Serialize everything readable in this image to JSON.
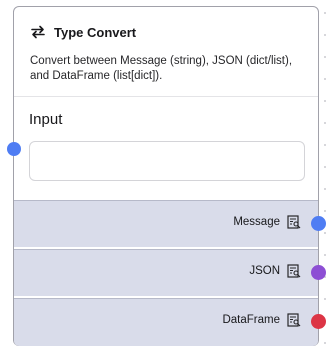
{
  "node": {
    "title": "Type Convert",
    "description": "Convert between Message (string), JSON (dict/list), and DataFrame (list[dict]).",
    "icon": "arrows-swap-icon"
  },
  "input": {
    "label": "Input",
    "value": "",
    "placeholder": "",
    "handle_color": "#4f7df3"
  },
  "outputs": [
    {
      "label": "Message",
      "icon": "inspect-icon",
      "handle_color": "#4f7df3"
    },
    {
      "label": "JSON",
      "icon": "inspect-icon",
      "handle_color": "#8d4fd4"
    },
    {
      "label": "DataFrame",
      "icon": "inspect-icon",
      "handle_color": "#dc3545"
    }
  ]
}
